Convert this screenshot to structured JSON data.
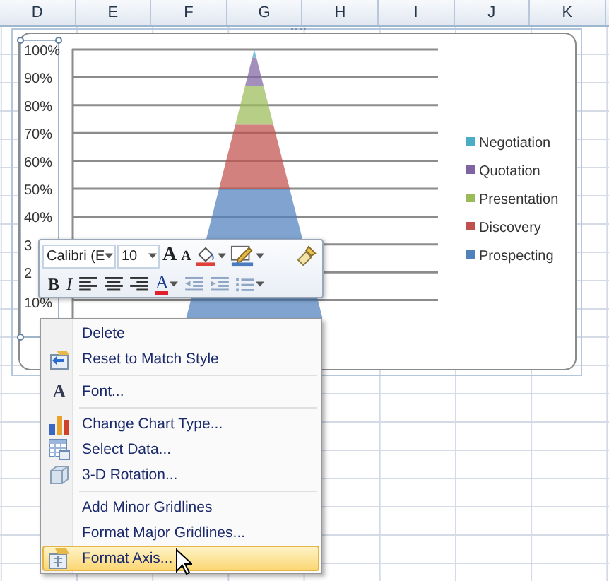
{
  "sheet": {
    "columns": [
      "D",
      "E",
      "F",
      "G",
      "H",
      "I",
      "J",
      "K"
    ]
  },
  "chart": {
    "axis_labels": [
      "100%",
      "90%",
      "80%",
      "70%",
      "60%",
      "50%",
      "40%",
      "3",
      "2",
      "10%"
    ],
    "legend": [
      {
        "name": "Negotiation",
        "color": "#4bacc6"
      },
      {
        "name": "Quotation",
        "color": "#8064a2"
      },
      {
        "name": "Presentation",
        "color": "#9bbb59"
      },
      {
        "name": "Discovery",
        "color": "#c0504d"
      },
      {
        "name": "Prospecting",
        "color": "#4f81bd"
      }
    ]
  },
  "mini_toolbar": {
    "font_name": "Calibri (E",
    "font_size": "10",
    "font_buttons": [
      {
        "kind": "grow",
        "text": "A"
      },
      {
        "kind": "shrink",
        "text": "A"
      },
      {
        "kind": "fill",
        "has_menu": true
      },
      {
        "kind": "outline",
        "has_menu": true
      },
      {
        "kind": "painter"
      }
    ],
    "format_buttons": [
      {
        "kind": "bold",
        "text": "B"
      },
      {
        "kind": "italic",
        "text": "I"
      },
      {
        "kind": "align-left"
      },
      {
        "kind": "align-center"
      },
      {
        "kind": "align-right"
      },
      {
        "kind": "font-color",
        "text": "A",
        "has_menu": true
      },
      {
        "kind": "outdent"
      },
      {
        "kind": "indent"
      },
      {
        "kind": "bullets",
        "has_menu": true
      }
    ]
  },
  "context_menu": {
    "items": [
      {
        "kind": "item",
        "label": "Delete",
        "selected": false
      },
      {
        "kind": "item",
        "label": "Reset to Match Style",
        "selected": false
      },
      {
        "kind": "separator"
      },
      {
        "kind": "item",
        "label": "Font...",
        "icon_text": "A",
        "selected": false
      },
      {
        "kind": "separator"
      },
      {
        "kind": "item",
        "label": "Change Chart Type...",
        "selected": false
      },
      {
        "kind": "item",
        "label": "Select Data...",
        "selected": false
      },
      {
        "kind": "item",
        "label": "3-D Rotation...",
        "selected": false
      },
      {
        "kind": "separator"
      },
      {
        "kind": "item",
        "label": "Add Minor Gridlines",
        "selected": false
      },
      {
        "kind": "item",
        "label": "Format Major Gridlines...",
        "selected": false
      },
      {
        "kind": "item",
        "label": "Format Axis...",
        "selected": true
      }
    ]
  }
}
